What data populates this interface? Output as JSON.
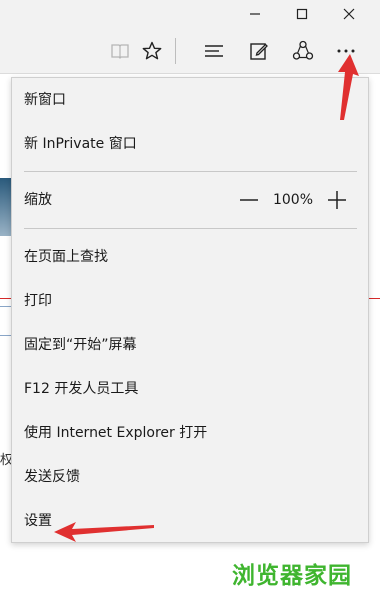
{
  "menu": {
    "new_window": "新窗口",
    "new_inprivate": "新 InPrivate 窗口",
    "zoom": {
      "label": "缩放",
      "level": "100%",
      "decrease_icon": "minus-icon",
      "increase_icon": "plus-icon"
    },
    "find_on_page": "在页面上查找",
    "print": "打印",
    "pin_to_start": "固定到“开始”屏幕",
    "f12_dev_tools": "F12 开发人员工具",
    "open_with_ie": "使用 Internet Explorer 打开",
    "send_feedback": "发送反馈",
    "settings": "设置"
  },
  "background": {
    "partial_char": "权"
  },
  "toolbar_icons": [
    "reading-view-icon",
    "favorite-star-icon",
    "hub-icon",
    "web-note-icon",
    "share-icon",
    "more-actions-icon"
  ],
  "window_icons": [
    "minimize-icon",
    "maximize-icon",
    "close-icon"
  ],
  "watermark": "浏览器家园",
  "colors": {
    "menu_bg": "#f2f2f2",
    "annotation_red": "#e03030",
    "watermark_green": "#3fb52f"
  }
}
